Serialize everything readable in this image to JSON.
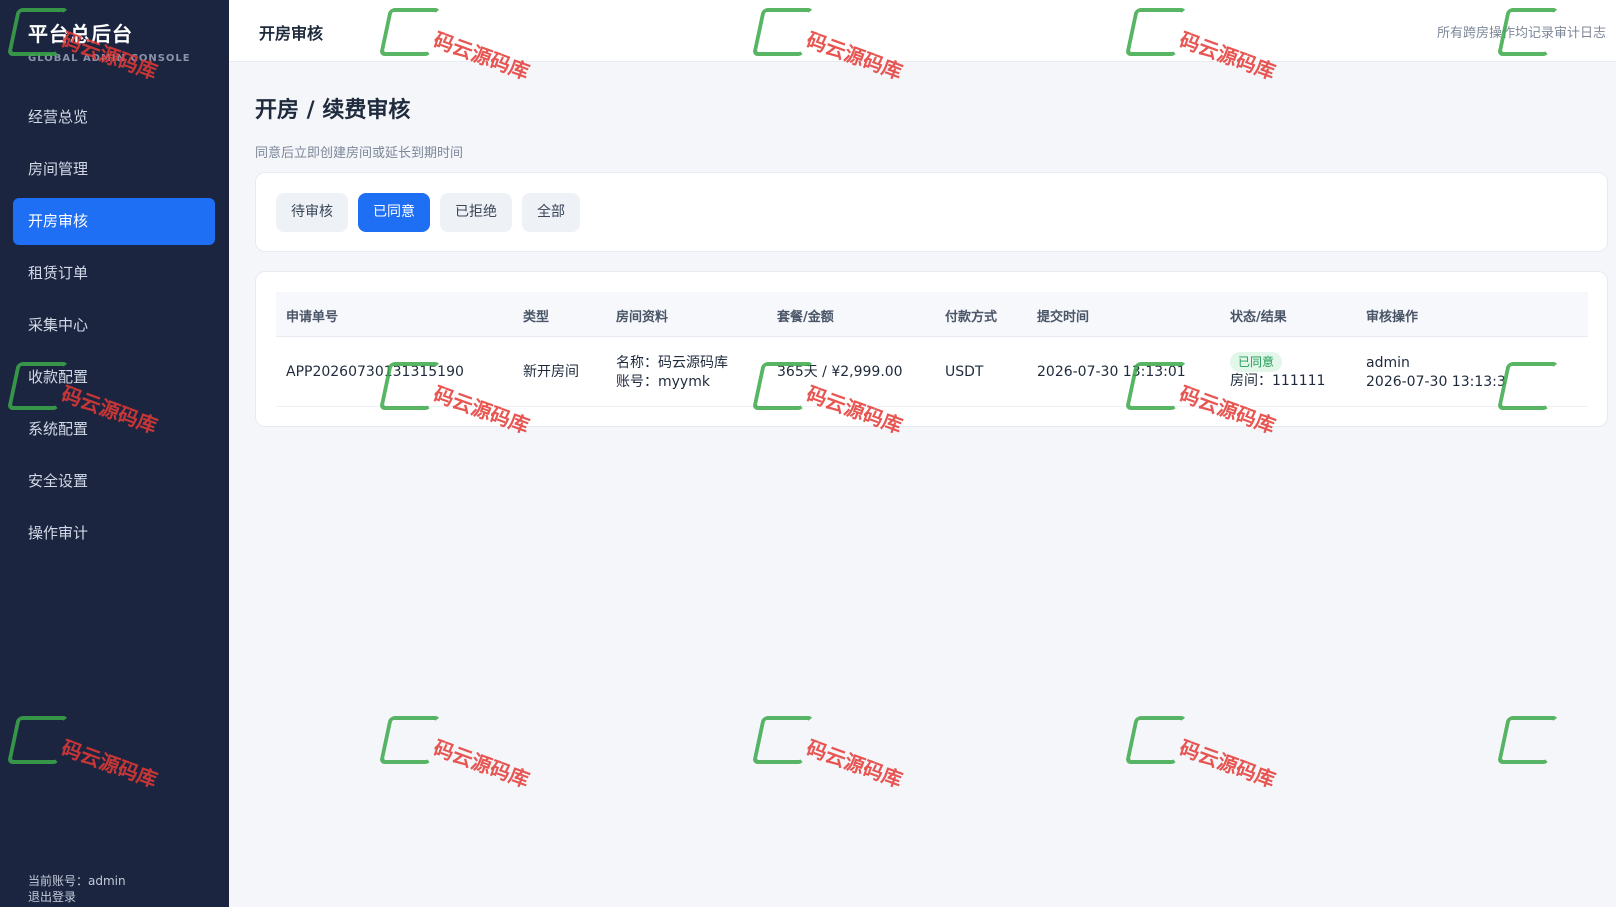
{
  "sidebar": {
    "brand_title": "平台总后台",
    "brand_subtitle": "GLOBAL ADMIN CONSOLE",
    "items": [
      {
        "label": "经营总览",
        "active": false
      },
      {
        "label": "房间管理",
        "active": false
      },
      {
        "label": "开房审核",
        "active": true
      },
      {
        "label": "租赁订单",
        "active": false
      },
      {
        "label": "采集中心",
        "active": false
      },
      {
        "label": "收款配置",
        "active": false
      },
      {
        "label": "系统配置",
        "active": false
      },
      {
        "label": "安全设置",
        "active": false
      },
      {
        "label": "操作审计",
        "active": false
      }
    ],
    "current_account": "当前账号：admin",
    "logout_label": "退出登录"
  },
  "topbar": {
    "title": "开房审核",
    "note": "所有跨房操作均记录审计日志"
  },
  "page": {
    "title": "开房 / 续费审核",
    "description": "同意后立即创建房间或延长到期时间"
  },
  "filters": [
    {
      "label": "待审核",
      "active": false
    },
    {
      "label": "已同意",
      "active": true
    },
    {
      "label": "已拒绝",
      "active": false
    },
    {
      "label": "全部",
      "active": false
    }
  ],
  "table": {
    "headers": [
      "申请单号",
      "类型",
      "房间资料",
      "套餐/金额",
      "付款方式",
      "提交时间",
      "状态/结果",
      "审核操作"
    ],
    "rows": [
      {
        "id": "APP20260730131315190",
        "type": "新开房间",
        "room_name": "名称：码云源码库",
        "room_account": "账号：myymk",
        "plan": "365天 / ¥2,999.00",
        "payment": "USDT",
        "submitted": "2026-07-30 13:13:01",
        "status": "已同意",
        "room": "房间：111111",
        "reviewer": "admin",
        "reviewed_at": "2026-07-30 13:13:3"
      }
    ]
  },
  "watermark_text": "码云源码库",
  "colors": {
    "sidebar_bg": "#1b2540",
    "accent": "#1e6ff3",
    "success": "#1f9d55",
    "watermark_red": "#e53935",
    "watermark_green": "#3ba94a"
  }
}
